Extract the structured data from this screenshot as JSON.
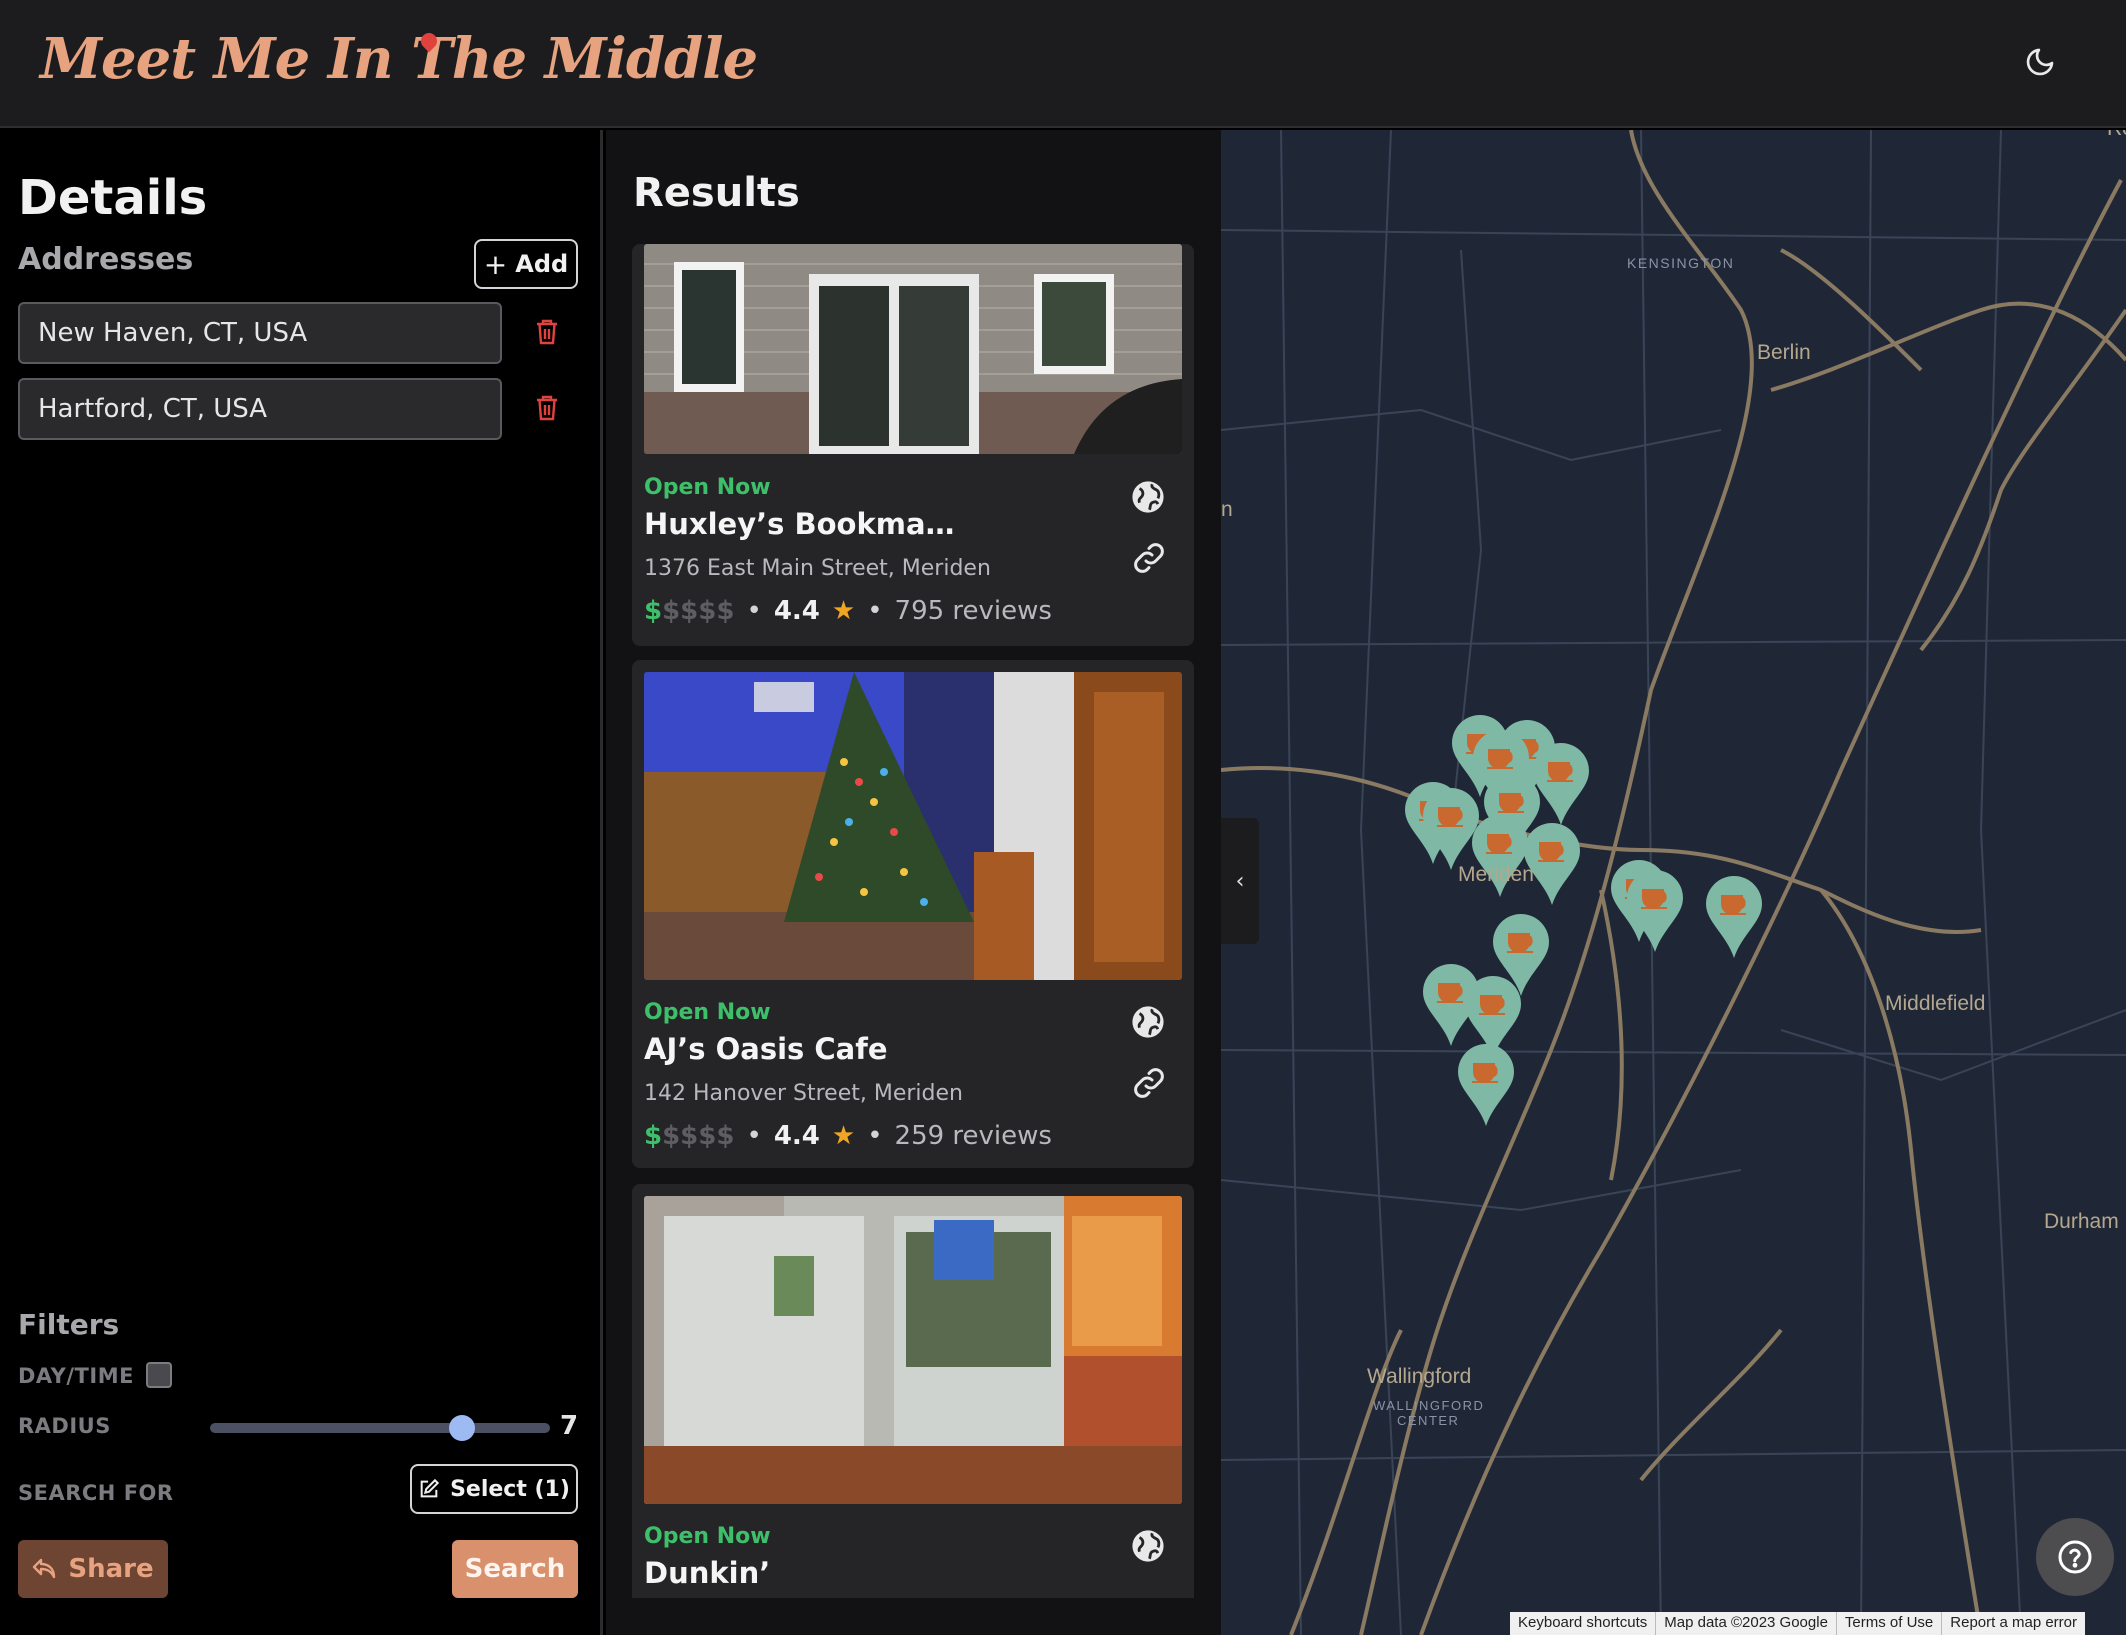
{
  "app": {
    "title": "Meet Me In The Middle"
  },
  "header": {
    "theme_icon": "moon-icon"
  },
  "details": {
    "title": "Details",
    "addresses_label": "Addresses",
    "add_label": "Add",
    "addresses": [
      {
        "value": "New Haven, CT, USA"
      },
      {
        "value": "Hartford, CT, USA"
      }
    ],
    "filters_label": "Filters",
    "daytime_label": "DAY/TIME",
    "daytime_checked": false,
    "radius_label": "RADIUS",
    "radius_value": "7",
    "radius_fraction": 0.74,
    "search_for_label": "SEARCH FOR",
    "select_label": "Select (1)",
    "share_label": "Share",
    "search_label": "Search"
  },
  "results": {
    "title": "Results",
    "items": [
      {
        "status": "Open Now",
        "name": "Huxley’s Bookma…",
        "address": "1376 East Main Street, Meriden",
        "price_on": "$",
        "price_off": "$$$$",
        "rating": "4.4",
        "reviews": "795 reviews"
      },
      {
        "status": "Open Now",
        "name": "AJ’s Oasis Cafe",
        "address": "142 Hanover Street, Meriden",
        "price_on": "$",
        "price_off": "$$$$",
        "rating": "4.4",
        "reviews": "259 reviews"
      },
      {
        "status": "Open Now",
        "name": "Dunkin’"
      }
    ]
  },
  "map": {
    "labels": {
      "kensington": "KENSINGTON",
      "berlin": "Berlin",
      "meriden": "Meriden",
      "middlefield": "Middlefield",
      "durham": "Durham",
      "wallingford": "Wallingford",
      "wallingford_center_1": "WALLINGFORD",
      "wallingford_center_2": "CENTER",
      "partial_left": "n",
      "partial_top": "Ro"
    },
    "attribution": {
      "shortcuts": "Keyboard shortcuts",
      "data": "Map data ©2023 Google",
      "terms": "Terms of Use",
      "report": "Report a map error"
    },
    "colors": {
      "background": "#1f2737",
      "road": "#8a7a62",
      "pin": "#7fb8a4",
      "pin_icon": "#c9692f"
    }
  }
}
